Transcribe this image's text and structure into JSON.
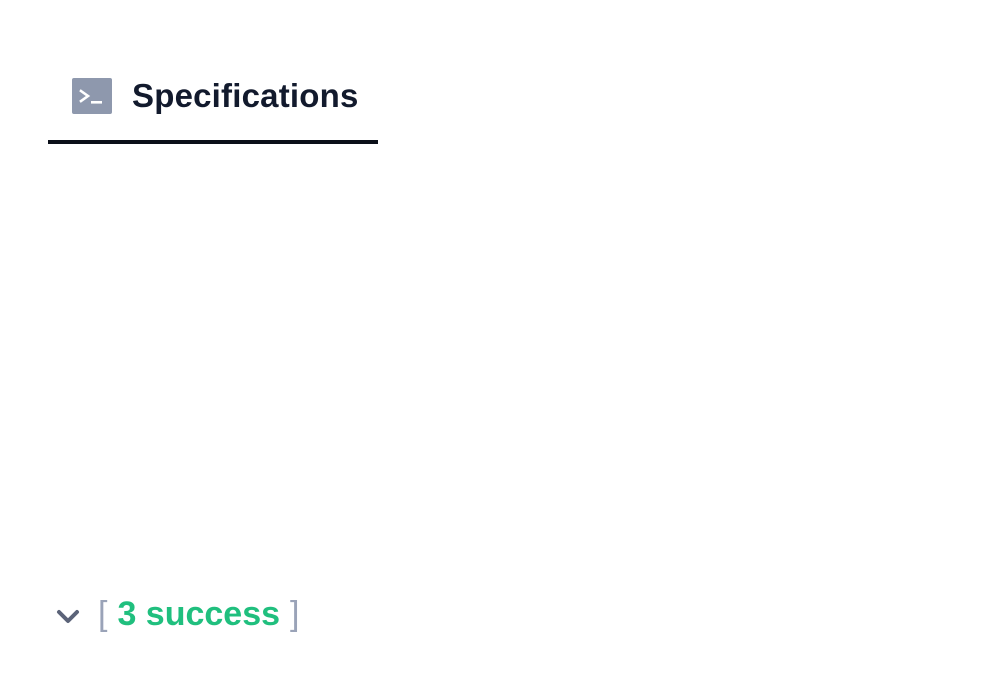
{
  "tab": {
    "label": "Specifications",
    "icon": "terminal-icon",
    "icon_color": "#8e98ad",
    "active_underline_color": "#0b0f19"
  },
  "summary": {
    "open_bracket": "[",
    "text": "3 success",
    "close_bracket": "]",
    "expand_icon": "chevron-down-icon",
    "success_color": "#20bf7e",
    "bracket_color": "#9aa3b8"
  }
}
